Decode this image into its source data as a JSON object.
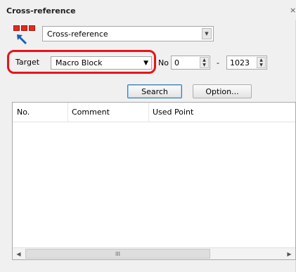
{
  "window": {
    "title": "Cross-reference",
    "close_label": "×"
  },
  "mode": {
    "selected": "Cross-reference",
    "icon": "cross-reference-icon"
  },
  "target": {
    "label": "Target",
    "selected": "Macro Block"
  },
  "range": {
    "no_label": "No",
    "from": "0",
    "dash": "-",
    "to": "1023"
  },
  "buttons": {
    "search": "Search",
    "option": "Option..."
  },
  "table": {
    "columns": [
      "No.",
      "Comment",
      "Used Point"
    ],
    "rows": []
  },
  "scrollbar": {
    "thumb_grip": "III"
  },
  "colors": {
    "highlight": "#e8141b",
    "icon_red": "#e32a1b",
    "icon_arrow": "#1c5fb3"
  }
}
